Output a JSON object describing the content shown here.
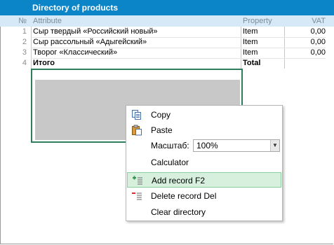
{
  "title": "Directory of products",
  "columns": {
    "num": "№",
    "attribute": "Attribute",
    "property": "Property",
    "vat": "VAT"
  },
  "rows": [
    {
      "num": "1",
      "attribute": "Сыр твердый «Российский новый»",
      "property": "Item",
      "vat": "0,00"
    },
    {
      "num": "2",
      "attribute": "Сыр рассольный «Адыгейский»",
      "property": "Item",
      "vat": "0,00"
    },
    {
      "num": "3",
      "attribute": "Творог «Классический»",
      "property": "Item",
      "vat": "0,00"
    }
  ],
  "total": {
    "num": "4",
    "attribute": "Итого",
    "property": "Total"
  },
  "context_menu": {
    "copy": "Copy",
    "paste": "Paste",
    "zoom_label": "Масштаб:",
    "zoom_value": "100%",
    "calculator": "Calculator",
    "add_record": "Add record  F2",
    "delete_record": "Delete record Del",
    "clear_directory": "Clear directory"
  },
  "colors": {
    "title_bg": "#0c84c8",
    "header_bg": "#d5e9f7",
    "selection_border": "#2e7d5b",
    "highlight": "#d6f0dd"
  },
  "icons": [
    "copy-icon",
    "paste-icon",
    "add-record-icon",
    "delete-record-icon",
    "dropdown-arrow-icon"
  ]
}
